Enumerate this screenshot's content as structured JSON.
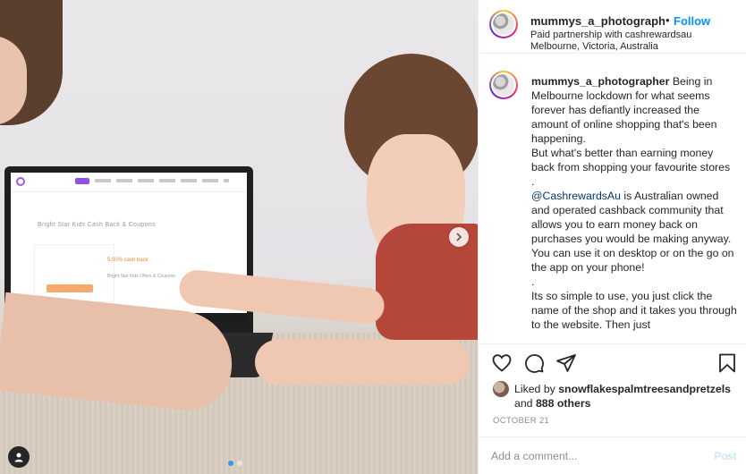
{
  "post": {
    "username": "mummys_a_photographer",
    "separator": "•",
    "follow_label": "Follow",
    "paid_partnership": "Paid partnership with cashrewardsau",
    "location": "Melbourne, Victoria, Australia",
    "caption": {
      "username": "mummys_a_photographer",
      "line1": "Being in Melbourne lockdown for what seems forever has defiantly increased the amount of online shopping that's been happening.",
      "line2": "But what's better than earning money back from shopping your favourite stores",
      "dot1": ".",
      "mention": "@CashrewardsAu",
      "line3": " is Australian owned and operated cashback community that allows you to earn money back on purchases you would be making anyway. You can use it on desktop or on the go on the app on your phone!",
      "dot2": ".",
      "line4": "Its so simple to use, you just click the name of the shop and it takes you through to the website. Then just"
    },
    "likes": {
      "prefix": "Liked by ",
      "user": "snowflakespalmtreesandpretzels",
      "mid": " and ",
      "others": "888 others"
    },
    "date": "OCTOBER 21",
    "comment_placeholder": "Add a comment...",
    "post_label": "Post"
  },
  "photo": {
    "laptop_screen": {
      "page_title": "Bright Star Kids Cash Back & Coupons",
      "cashback": "5.00% cash back",
      "offers_title": "Bright Star Kids Offers & Coupons"
    },
    "carousel": {
      "total": 2,
      "current": 1
    }
  },
  "icons": {
    "heart": "heart-icon",
    "comment": "comment-icon",
    "share": "share-icon",
    "save": "bookmark-icon",
    "next": "chevron-right-icon",
    "tag": "user-tag-icon"
  },
  "colors": {
    "link": "#0095f6",
    "mention": "#00376b",
    "post_disabled": "#b2dffc",
    "muted": "#8e8e8e"
  }
}
